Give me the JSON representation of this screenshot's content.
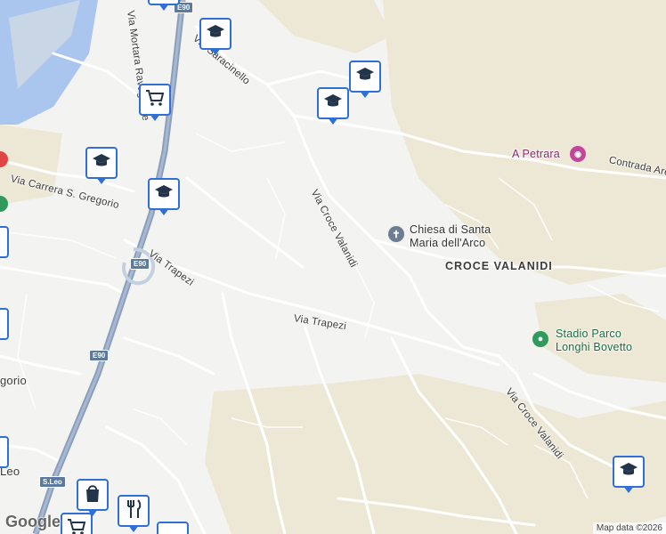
{
  "labels": {
    "via_mortara": "Via Mortara Ravagnese",
    "via_saracinello": "Via Saracinello",
    "via_carrera": "Via Carrera S. Gregorio",
    "via_croce_top": "Via Croce Valanidi",
    "via_trapezi_1": "Via Trapezi",
    "via_trapezi_2": "Via Trapezi",
    "croce_valanidi": "CROCE VALANIDI",
    "via_croce_bottom": "Via Croce Valanidi",
    "contrada": "Contrada Areti",
    "gregorio": "gorio",
    "leo": "Leo"
  },
  "pois": {
    "chiesa": "Chiesa di Santa Maria dell'Arco",
    "chiesa_line1": "Chiesa di Santa",
    "chiesa_line2": "Maria dell'Arco",
    "stadio_line1": "Stadio Parco",
    "stadio_line2": "Longhi Bovetto",
    "petrara": "A Petrara"
  },
  "shields": {
    "e90_top": "E90",
    "e90_mid": "E90",
    "e90_low": "E90",
    "sleo": "S.Leo"
  },
  "markers": [
    {
      "type": "school",
      "icon": "graduation-cap-icon"
    },
    {
      "type": "school",
      "icon": "graduation-cap-icon"
    },
    {
      "type": "school",
      "icon": "graduation-cap-icon"
    },
    {
      "type": "school",
      "icon": "graduation-cap-icon"
    },
    {
      "type": "school",
      "icon": "graduation-cap-icon"
    },
    {
      "type": "school",
      "icon": "graduation-cap-icon"
    },
    {
      "type": "grocery",
      "icon": "shopping-cart-icon"
    },
    {
      "type": "grocery",
      "icon": "shopping-cart-icon"
    },
    {
      "type": "shop",
      "icon": "shopping-bag-icon"
    },
    {
      "type": "restaurant",
      "icon": "fork-knife-icon"
    }
  ],
  "footer": {
    "logo": "Google",
    "attribution": "Map data ©2026"
  },
  "colors": {
    "background": "#f3f3f1",
    "terrain": "#ede8d5",
    "highway": "#8a9fbd",
    "road": "#ffffff",
    "water": "#aac6ef",
    "marker_border": "#2f6fd6"
  }
}
